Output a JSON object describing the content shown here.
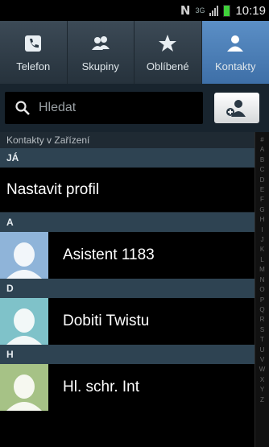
{
  "status_bar": {
    "network_mark": "N",
    "data_mark": "3G",
    "clock": "10:19"
  },
  "tabs": [
    {
      "label": "Telefon",
      "icon": "phone-icon",
      "active": false
    },
    {
      "label": "Skupiny",
      "icon": "group-icon",
      "active": false
    },
    {
      "label": "Oblíbené",
      "icon": "star-icon",
      "active": false
    },
    {
      "label": "Kontakty",
      "icon": "person-icon",
      "active": true
    }
  ],
  "search": {
    "placeholder": "Hledat",
    "add_button_icon": "add-contact-icon"
  },
  "list": {
    "section_title": "Kontakty v Zařízení",
    "me_header": "JÁ",
    "profile_row": "Nastavit profil",
    "groups": [
      {
        "letter": "A",
        "contacts": [
          {
            "name": "Asistent 1183",
            "avatar_color": "#8fb4d9"
          }
        ]
      },
      {
        "letter": "D",
        "contacts": [
          {
            "name": "Dobiti Twistu",
            "avatar_color": "#7fc2c9"
          }
        ]
      },
      {
        "letter": "H",
        "contacts": [
          {
            "name": "Hl. schr. Int",
            "avatar_color": "#a6c286"
          }
        ]
      }
    ]
  },
  "index_letters": [
    "#",
    "A",
    "B",
    "C",
    "D",
    "E",
    "F",
    "G",
    "H",
    "I",
    "J",
    "K",
    "L",
    "M",
    "N",
    "O",
    "P",
    "Q",
    "R",
    "S",
    "T",
    "U",
    "V",
    "W",
    "X",
    "Y",
    "Z"
  ],
  "colors": {
    "active_tab": "#4f82bd",
    "group_header": "#2e4352",
    "battery": "#3fd13a"
  }
}
